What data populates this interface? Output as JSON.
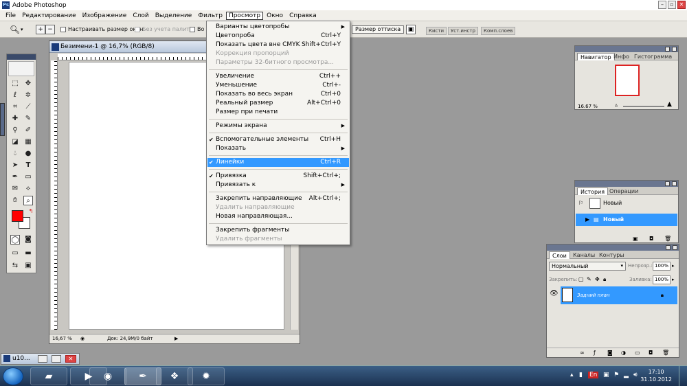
{
  "window": {
    "title": "Adobe Photoshop"
  },
  "menubar": [
    "File",
    "Редактирование",
    "Изображение",
    "Слой",
    "Выделение",
    "Фильтр",
    "Просмотр",
    "Окно",
    "Справка"
  ],
  "options": {
    "resize_windows": "Настраивать размер окон",
    "ignore_palettes": "Без учета палитр",
    "all_windows": "Во в",
    "proof_size": "Размер оттиска"
  },
  "palette_well": [
    "Кисти",
    "Уст.инстр",
    "Комп.слоев"
  ],
  "document": {
    "title": "Безимени-1 @ 16,7% (RGB/8)",
    "zoom": "16,67 %",
    "info": "Док: 24,9M/0 байт"
  },
  "view_menu": {
    "items": [
      {
        "label": "Варианты цветопробы",
        "shortcut": ""
      },
      {
        "label": "Цветопроба",
        "shortcut": "Ctrl+Y"
      },
      {
        "label": "Показать цвета вне CMYK",
        "shortcut": "Shift+Ctrl+Y"
      },
      {
        "label": "Коррекция пропорций",
        "shortcut": ""
      },
      {
        "label": "Параметры 32-битного просмотра...",
        "shortcut": ""
      },
      {
        "label": "Увеличение",
        "shortcut": "Ctrl++"
      },
      {
        "label": "Уменьшение",
        "shortcut": "Ctrl+-"
      },
      {
        "label": "Показать во весь экран",
        "shortcut": "Ctrl+0"
      },
      {
        "label": "Реальный размер",
        "shortcut": "Alt+Ctrl+0"
      },
      {
        "label": "Размер при печати",
        "shortcut": ""
      },
      {
        "label": "Режимы экрана",
        "shortcut": ""
      },
      {
        "label": "Вспомогательные элементы",
        "shortcut": "Ctrl+H"
      },
      {
        "label": "Показать",
        "shortcut": ""
      },
      {
        "label": "Линейки",
        "shortcut": "Ctrl+R"
      },
      {
        "label": "Привязка",
        "shortcut": "Shift+Ctrl+;"
      },
      {
        "label": "Привязать к",
        "shortcut": ""
      },
      {
        "label": "Закрепить направляющие",
        "shortcut": "Alt+Ctrl+;"
      },
      {
        "label": "Удалить направляющие",
        "shortcut": ""
      },
      {
        "label": "Новая направляющая...",
        "shortcut": ""
      },
      {
        "label": "Закрепить фрагменты",
        "shortcut": ""
      },
      {
        "label": "Удалить фрагменты",
        "shortcut": ""
      }
    ]
  },
  "navigator": {
    "tabs": [
      "Навигатор",
      "Инфо",
      "Гистограмма"
    ],
    "zoom": "16.67 %"
  },
  "history": {
    "tabs": [
      "История",
      "Операции"
    ],
    "items": [
      "Новый",
      "Новый"
    ]
  },
  "layers": {
    "tabs": [
      "Слои",
      "Каналы",
      "Контуры"
    ],
    "blend_mode": "Нормальный",
    "opacity_label": "Непрозр.:",
    "opacity": "100%",
    "lock_label": "Закрепить:",
    "fill_label": "Заливка:",
    "fill": "100%",
    "layer_name": "Задний план"
  },
  "minimized_doc": "u10...",
  "taskbar": {
    "lang": "En",
    "time": "17:10",
    "date": "31.10.2012"
  },
  "colors": {
    "foreground": "#ff0000",
    "highlight": "#3399ff"
  }
}
